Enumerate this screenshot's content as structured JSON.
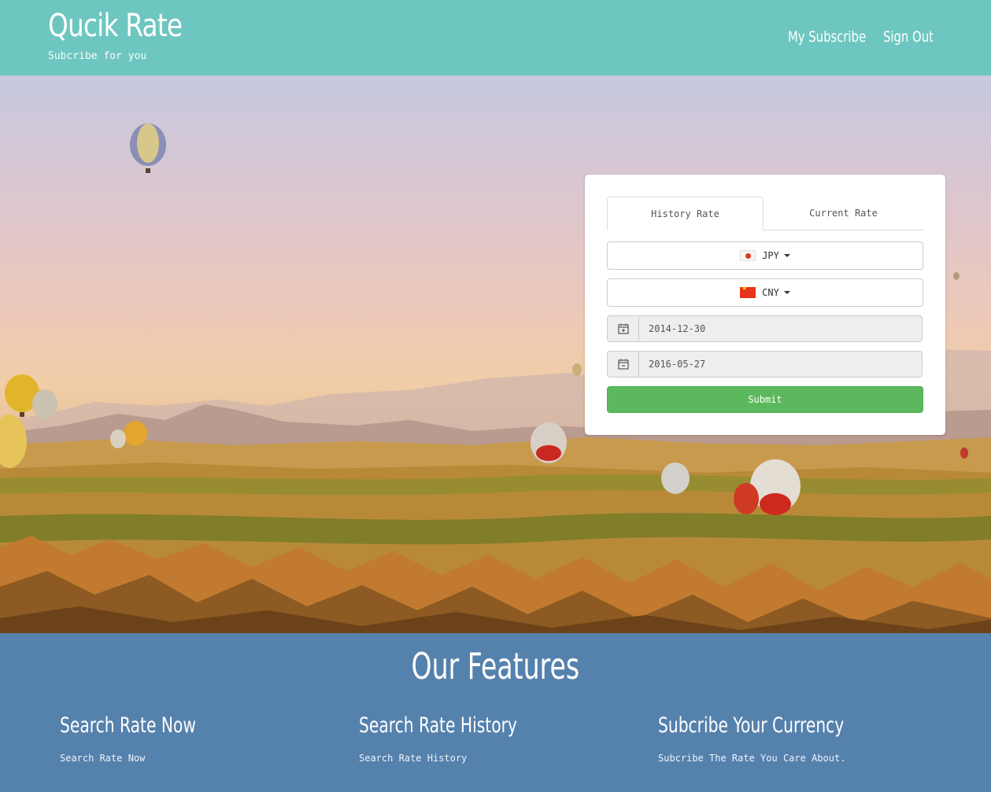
{
  "brand": {
    "title": "Qucik Rate",
    "subtitle": "Subcribe for you"
  },
  "nav": {
    "items": [
      {
        "label": "My Subscribe"
      },
      {
        "label": "Sign Out"
      }
    ]
  },
  "form": {
    "tabs": [
      {
        "label": "History Rate",
        "active": true
      },
      {
        "label": "Current Rate",
        "active": false
      }
    ],
    "from_currency": {
      "code": "JPY",
      "flag": "japan-flag"
    },
    "to_currency": {
      "code": "CNY",
      "flag": "china-flag"
    },
    "start_date": {
      "value": "2014-12-30",
      "icon": "calendar-plus-icon"
    },
    "end_date": {
      "value": "2016-05-27",
      "icon": "calendar-minus-icon"
    },
    "submit_label": "Submit"
  },
  "features": {
    "title": "Our Features",
    "items": [
      {
        "title": "Search Rate Now",
        "text": "Search Rate Now"
      },
      {
        "title": "Search Rate History",
        "text": "Search Rate History"
      },
      {
        "title": "Subcribe Your Currency",
        "text": "Subcribe The Rate You Care About."
      }
    ]
  },
  "colors": {
    "header": "#6ec6c0",
    "features": "#5581ad",
    "submit": "#5cb85c"
  }
}
